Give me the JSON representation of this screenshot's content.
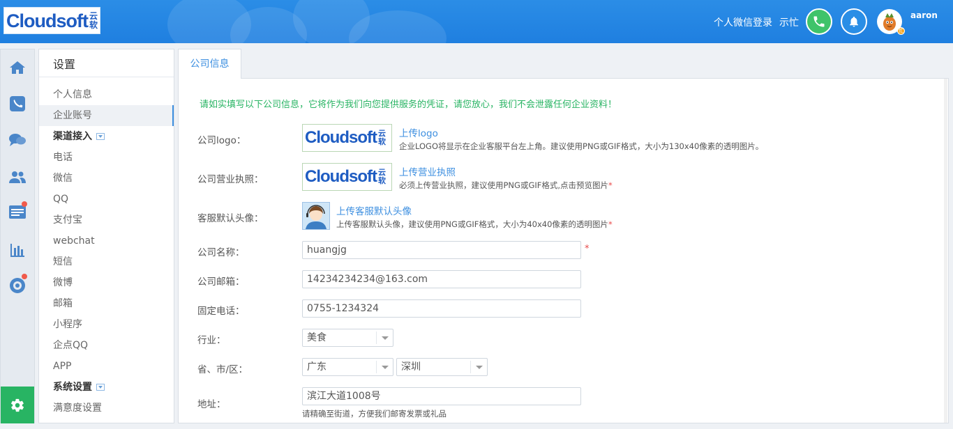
{
  "header": {
    "logo_word": "Cloudsoft",
    "logo_cn_top": "云",
    "logo_cn_bottom": "软",
    "wechat_login": "个人微信登录",
    "status": "示忙",
    "username": "aaron",
    "avatar_badge": "忙",
    "phone_icon": "phone-icon",
    "bell_icon": "bell-icon",
    "accent_color": "#1f7fe0"
  },
  "rail": {
    "icons": [
      "home-icon",
      "phone-icon",
      "chat-icon",
      "users-icon",
      "tickets-icon",
      "stats-icon",
      "monitor-icon",
      "settings-icon"
    ],
    "active_color": "#28b463"
  },
  "sidebar": {
    "title": "设置",
    "items": [
      {
        "label": "个人信息"
      },
      {
        "label": "企业账号"
      },
      {
        "label": "渠道接入"
      },
      {
        "label": "电话"
      },
      {
        "label": "微信"
      },
      {
        "label": "QQ"
      },
      {
        "label": "支付宝"
      },
      {
        "label": "webchat"
      },
      {
        "label": "短信"
      },
      {
        "label": "微博"
      },
      {
        "label": "邮箱"
      },
      {
        "label": "小程序"
      },
      {
        "label": "企点QQ"
      },
      {
        "label": "APP"
      },
      {
        "label": "系统设置"
      },
      {
        "label": "满意度设置"
      }
    ]
  },
  "tab": {
    "label": "公司信息"
  },
  "form": {
    "notice": "请如实填写以下公司信息，它将作为我们向您提供服务的凭证，请您放心，我们不会泄露任何企业资料！",
    "logo": {
      "label": "公司logo：",
      "link": "上传logo",
      "hint": "企业LOGO将显示在企业客服平台左上角。建议使用PNG或GIF格式，大小为130x40像素的透明图片。"
    },
    "license": {
      "label": "公司营业执照：",
      "link": "上传营业执照",
      "hint": "必须上传营业执照，建议使用PNG或GIF格式,点击预览图片",
      "req": "*"
    },
    "avatar": {
      "label": "客服默认头像：",
      "link": "上传客服默认头像",
      "hint": "上传客服默认头像，建议使用PNG或GIF格式，大小为40x40像素的透明图片",
      "req": "*"
    },
    "name": {
      "label": "公司名称：",
      "value": "huangjg",
      "req": "*"
    },
    "email": {
      "label": "公司邮箱：",
      "value": "14234234234@163.com"
    },
    "phone": {
      "label": "固定电话：",
      "value": "0755-1234324"
    },
    "industry": {
      "label": "行业：",
      "value": "美食"
    },
    "region": {
      "label": "省、市/区：",
      "province": "广东",
      "city": "深圳"
    },
    "address": {
      "label": "地址：",
      "value": "滨江大道1008号",
      "hint": "请精确至街道，方便我们邮寄发票或礼品"
    }
  }
}
